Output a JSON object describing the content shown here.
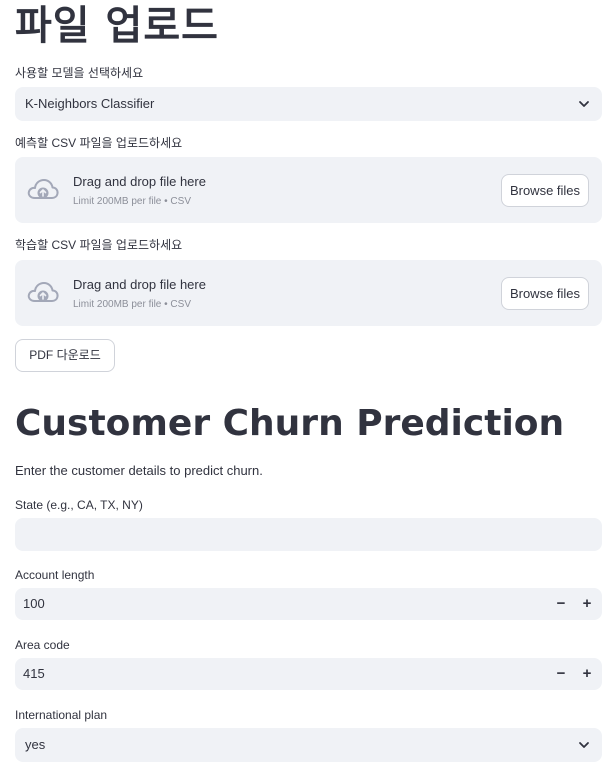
{
  "upload_section": {
    "title": "파일 업로드",
    "model_label": "사용할 모델을 선택하세요",
    "model_selected": "K-Neighbors Classifier",
    "predict_csv_label": "예측할 CSV 파일을 업로드하세요",
    "train_csv_label": "학습할 CSV 파일을 업로드하세요",
    "dropzone": {
      "drag_text": "Drag and drop file here",
      "limit_text": "Limit 200MB per file • CSV",
      "browse_label": "Browse files"
    },
    "pdf_button_label": "PDF 다운로드"
  },
  "prediction_section": {
    "title": "Customer Churn Prediction",
    "description": "Enter the customer details to predict churn.",
    "fields": {
      "state": {
        "label": "State (e.g., CA, TX, NY)",
        "value": ""
      },
      "account_length": {
        "label": "Account length",
        "value": "100"
      },
      "area_code": {
        "label": "Area code",
        "value": "415"
      },
      "international_plan": {
        "label": "International plan",
        "value": "yes"
      }
    },
    "stepper": {
      "minus": "−",
      "plus": "+"
    }
  },
  "colors": {
    "input_bg": "#f0f2f6",
    "text": "#31333f",
    "muted": "#8c8f99",
    "icon": "#a3a8b8"
  },
  "icons": {
    "upload": "cloud-upload-icon",
    "dropdown": "chevron-down-icon"
  }
}
